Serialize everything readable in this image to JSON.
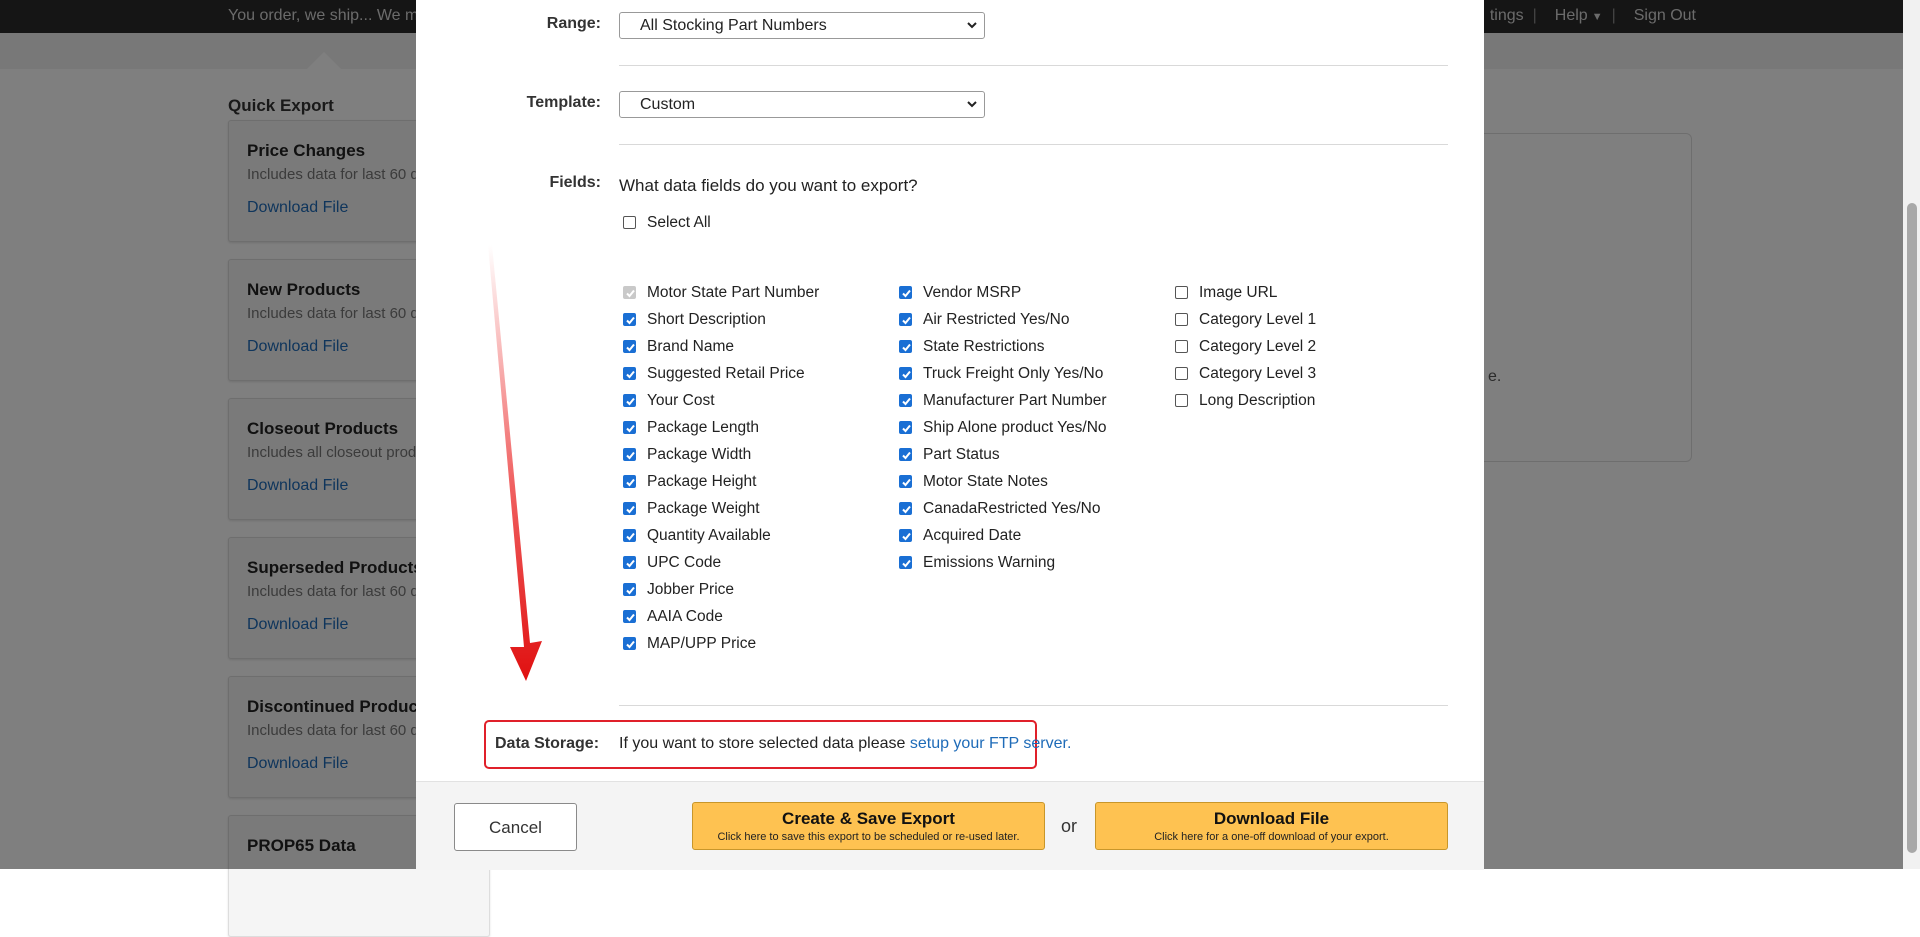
{
  "topbar": {
    "tagline": "You order, we ship... We ma",
    "links": [
      "tings",
      "Help",
      "Sign Out"
    ]
  },
  "quick_export": {
    "title": "Quick Export",
    "cards": [
      {
        "title": "Price Changes",
        "subtitle": "Includes data for last 60 d",
        "link": "Download File"
      },
      {
        "title": "New Products",
        "subtitle": "Includes data for last 60 d",
        "link": "Download File"
      },
      {
        "title": "Closeout Products",
        "subtitle": "Includes all closeout prod",
        "link": "Download File"
      },
      {
        "title": "Superseded Products",
        "subtitle": "Includes data for last 60 d",
        "link": "Download File"
      },
      {
        "title": "Discontinued Product",
        "subtitle": "Includes data for last 60 d",
        "link": "Download File"
      },
      {
        "title": "PROP65 Data",
        "subtitle": "",
        "link": ""
      }
    ],
    "right_panel_tail": "e."
  },
  "modal": {
    "range": {
      "label": "Range:",
      "value": "All Stocking Part Numbers"
    },
    "template": {
      "label": "Template:",
      "value": "Custom"
    },
    "fields": {
      "label": "Fields:",
      "question": "What data fields do you want to export?",
      "select_all": "Select All",
      "select_all_checked": false,
      "columns": [
        [
          {
            "label": "Motor State Part Number",
            "state": "disabled"
          },
          {
            "label": "Short Description",
            "state": "checked"
          },
          {
            "label": "Brand Name",
            "state": "checked"
          },
          {
            "label": "Suggested Retail Price",
            "state": "checked"
          },
          {
            "label": "Your Cost",
            "state": "checked"
          },
          {
            "label": "Package Length",
            "state": "checked"
          },
          {
            "label": "Package Width",
            "state": "checked"
          },
          {
            "label": "Package Height",
            "state": "checked"
          },
          {
            "label": "Package Weight",
            "state": "checked"
          },
          {
            "label": "Quantity Available",
            "state": "checked"
          },
          {
            "label": "UPC Code",
            "state": "checked"
          },
          {
            "label": "Jobber Price",
            "state": "checked"
          },
          {
            "label": "AAIA Code",
            "state": "checked"
          },
          {
            "label": "MAP/UPP Price",
            "state": "checked"
          }
        ],
        [
          {
            "label": "Vendor MSRP",
            "state": "checked"
          },
          {
            "label": "Air Restricted Yes/No",
            "state": "checked"
          },
          {
            "label": "State Restrictions",
            "state": "checked"
          },
          {
            "label": "Truck Freight Only Yes/No",
            "state": "checked"
          },
          {
            "label": "Manufacturer Part Number",
            "state": "checked"
          },
          {
            "label": "Ship Alone product Yes/No",
            "state": "checked"
          },
          {
            "label": "Part Status",
            "state": "checked"
          },
          {
            "label": "Motor State Notes",
            "state": "checked"
          },
          {
            "label": "CanadaRestricted Yes/No",
            "state": "checked"
          },
          {
            "label": "Acquired Date",
            "state": "checked"
          },
          {
            "label": "Emissions Warning",
            "state": "checked"
          }
        ],
        [
          {
            "label": "Image URL",
            "state": "unchecked"
          },
          {
            "label": "Category Level 1",
            "state": "unchecked"
          },
          {
            "label": "Category Level 2",
            "state": "unchecked"
          },
          {
            "label": "Category Level 3",
            "state": "unchecked"
          },
          {
            "label": "Long Description",
            "state": "unchecked"
          }
        ]
      ]
    },
    "data_storage": {
      "label": "Data Storage:",
      "text": "If you want to store selected data please ",
      "link": "setup your FTP server."
    },
    "footer": {
      "cancel": "Cancel",
      "create_title": "Create & Save Export",
      "create_sub": "Click here to save this export to be scheduled or re-used later.",
      "or": "or",
      "download_title": "Download File",
      "download_sub": "Click here for a one-off download of your export."
    }
  },
  "colors": {
    "accent_yellow": "#fec251",
    "checkbox_blue": "#1a6fd4",
    "highlight_red": "#e0202a",
    "link_blue": "#1e6bb8"
  }
}
